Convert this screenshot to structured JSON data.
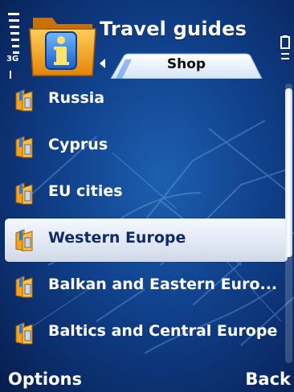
{
  "app": {
    "title": "Travel guides",
    "icon": "info-folder-icon"
  },
  "status": {
    "network_type": "3G",
    "signal_icon": "signal-strength-icon",
    "battery_icon": "battery-icon"
  },
  "tabs": {
    "active_label": "Shop",
    "prev_icon": "tab-left-arrow-icon"
  },
  "list": {
    "items": [
      {
        "label": "Russia",
        "icon": "guide-book-icon"
      },
      {
        "label": "Cyprus",
        "icon": "guide-book-icon"
      },
      {
        "label": "EU cities",
        "icon": "guide-book-icon"
      },
      {
        "label": "Western Europe",
        "icon": "guide-book-icon",
        "selected": true
      },
      {
        "label": "Balkan and Eastern Euro...",
        "icon": "guide-book-icon"
      },
      {
        "label": "Baltics and Central Europe",
        "icon": "guide-book-icon"
      }
    ]
  },
  "softkeys": {
    "left": "Options",
    "right": "Back"
  },
  "colors": {
    "background": "#10408a",
    "selected_row": "#e2e8f4",
    "selected_text": "#0f2a66",
    "text": "#ffffff",
    "folder_orange": "#f29a12"
  }
}
